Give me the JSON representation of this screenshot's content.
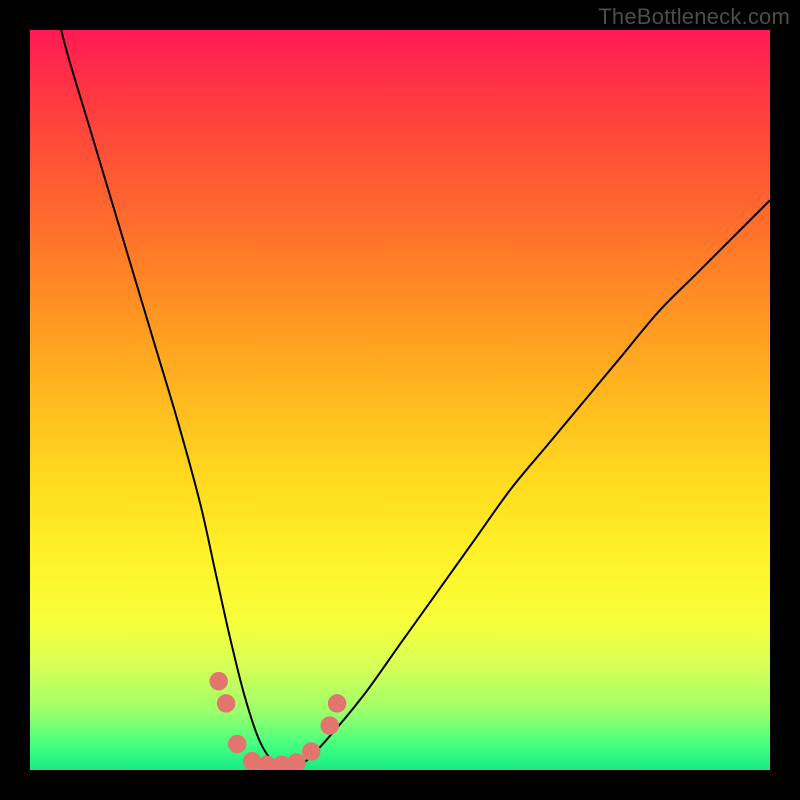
{
  "watermark": "TheBottleneck.com",
  "chart_data": {
    "type": "line",
    "title": "",
    "xlabel": "",
    "ylabel": "",
    "xlim": [
      0,
      100
    ],
    "ylim": [
      0,
      100
    ],
    "grid": false,
    "legend": null,
    "annotations": [],
    "background_gradient_stops": [
      {
        "pos": 0,
        "color": "#ff1a55"
      },
      {
        "pos": 10,
        "color": "#ff3b3f"
      },
      {
        "pos": 20,
        "color": "#ff5a33"
      },
      {
        "pos": 30,
        "color": "#ff7a28"
      },
      {
        "pos": 40,
        "color": "#ff9a21"
      },
      {
        "pos": 50,
        "color": "#ffba1f"
      },
      {
        "pos": 60,
        "color": "#ffd81f"
      },
      {
        "pos": 70,
        "color": "#fff027"
      },
      {
        "pos": 80,
        "color": "#f7ff3a"
      },
      {
        "pos": 86,
        "color": "#d7ff56"
      },
      {
        "pos": 92,
        "color": "#9dff6a"
      },
      {
        "pos": 97,
        "color": "#3dff81"
      },
      {
        "pos": 100,
        "color": "#18e884"
      }
    ],
    "series": [
      {
        "name": "bottleneck-curve",
        "color": "#000000",
        "x": [
          3,
          5,
          8,
          11,
          14,
          17,
          20,
          23,
          25,
          27,
          29,
          31,
          33,
          35,
          37,
          40,
          45,
          50,
          55,
          60,
          65,
          70,
          75,
          80,
          85,
          90,
          95,
          100
        ],
        "y": [
          105,
          97,
          87,
          77,
          67,
          57,
          47,
          36,
          27,
          18,
          10,
          4,
          1,
          0.5,
          1,
          4,
          10,
          17,
          24,
          31,
          38,
          44,
          50,
          56,
          62,
          67,
          72,
          77
        ]
      }
    ],
    "markers": {
      "name": "threshold-dots",
      "color": "#e2766f",
      "points": [
        {
          "x": 25.5,
          "y": 12
        },
        {
          "x": 26.5,
          "y": 9
        },
        {
          "x": 28,
          "y": 3.5
        },
        {
          "x": 30,
          "y": 1.2
        },
        {
          "x": 32,
          "y": 0.7
        },
        {
          "x": 34,
          "y": 0.7
        },
        {
          "x": 36,
          "y": 1
        },
        {
          "x": 38,
          "y": 2.5
        },
        {
          "x": 40.5,
          "y": 6
        },
        {
          "x": 41.5,
          "y": 9
        }
      ]
    }
  }
}
